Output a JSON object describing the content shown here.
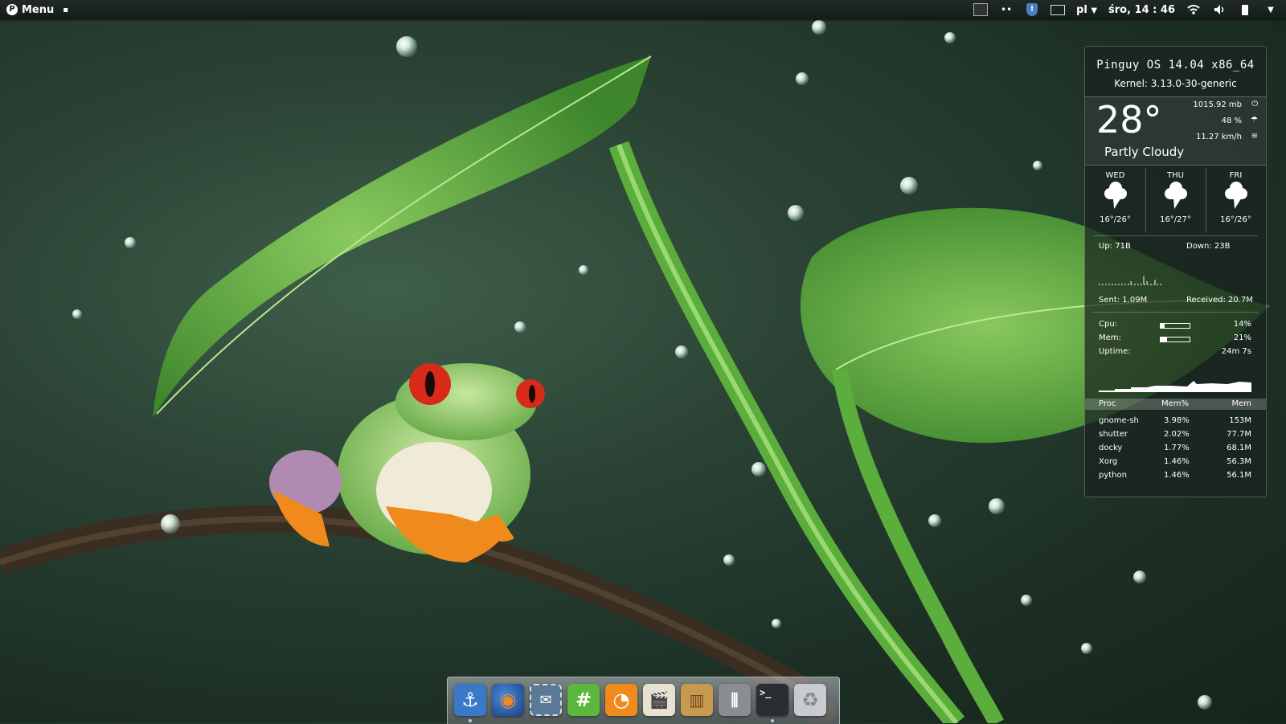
{
  "panel": {
    "menu_label": "Menu",
    "keyboard_layout": "pl",
    "clock": "śro, 14 : 46"
  },
  "conky": {
    "os": "Pinguy OS 14.04 x86_64",
    "kernel": "Kernel: 3.13.0-30-generic",
    "temperature": "28°",
    "pressure": "1015.92 mb",
    "humidity": "48 %",
    "wind": "11.27 km/h",
    "condition": "Partly Cloudy",
    "forecast": [
      {
        "day": "WED",
        "temp": "16°/26°",
        "icon": "thunderstorm-icon"
      },
      {
        "day": "THU",
        "temp": "16°/27°",
        "icon": "thunderstorm-icon"
      },
      {
        "day": "FRI",
        "temp": "16°/26°",
        "icon": "thunderstorm-icon"
      }
    ],
    "net_up": "Up: 71B",
    "net_down": "Down: 23B",
    "sent": "Sent: 1.09M",
    "received": "Received: 20.7M",
    "cpu_label": "Cpu:",
    "cpu_value": "14%",
    "cpu_fraction": 0.14,
    "mem_label": "Mem:",
    "mem_value": "21%",
    "mem_fraction": 0.21,
    "uptime_label": "Uptime:",
    "uptime_value": "24m 7s",
    "proc_headers": [
      "Proc",
      "Mem%",
      "Mem"
    ],
    "processes": [
      {
        "name": "gnome-sh",
        "mem_pct": "3.98%",
        "mem": "153M"
      },
      {
        "name": "shutter",
        "mem_pct": "2.02%",
        "mem": "77.7M"
      },
      {
        "name": "docky",
        "mem_pct": "1.77%",
        "mem": "68.1M"
      },
      {
        "name": "Xorg",
        "mem_pct": "1.46%",
        "mem": "56.3M"
      },
      {
        "name": "python",
        "mem_pct": "1.46%",
        "mem": "56.1M"
      }
    ]
  },
  "dock": {
    "items": [
      {
        "name": "docky-anchor",
        "icon": "anchor-icon",
        "color": "#3a78c8"
      },
      {
        "name": "firefox",
        "icon": "firefox-icon",
        "color": "#2a5ca8"
      },
      {
        "name": "mail-client",
        "icon": "mail-stamp-icon",
        "color": "#5a7a98"
      },
      {
        "name": "hashtag-app",
        "icon": "hashtag-icon",
        "color": "#5cb83c"
      },
      {
        "name": "music-player",
        "icon": "orange-slice-icon",
        "color": "#f08a1c"
      },
      {
        "name": "video-editor",
        "icon": "clapperboard-icon",
        "color": "#d8d0c0"
      },
      {
        "name": "archive-manager",
        "icon": "archive-icon",
        "color": "#c89a50"
      },
      {
        "name": "settings",
        "icon": "sliders-icon",
        "color": "#8a8e92"
      },
      {
        "name": "terminal",
        "icon": "terminal-icon",
        "color": "#2a2e32"
      },
      {
        "name": "trash",
        "icon": "trash-icon",
        "color": "#c8ccd0"
      }
    ]
  }
}
